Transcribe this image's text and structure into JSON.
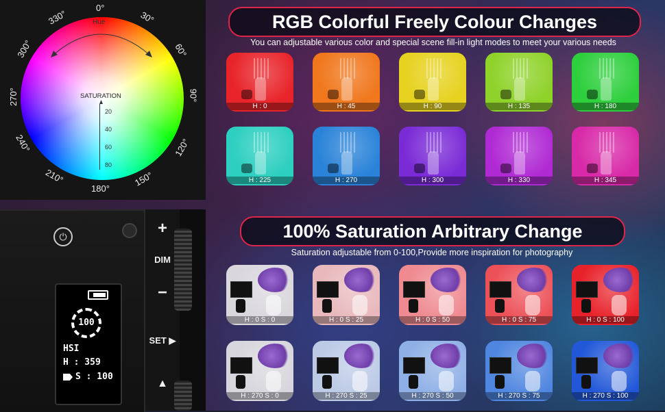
{
  "wheel": {
    "hue_label": "Hue",
    "saturation_label": "SATURATION",
    "degrees": [
      "0°",
      "30°",
      "60°",
      "90°",
      "120°",
      "150°",
      "180°",
      "210°",
      "240°",
      "270°",
      "300°",
      "330°"
    ],
    "saturation_ticks": [
      "20",
      "40",
      "60",
      "80"
    ]
  },
  "device": {
    "battery_value": "100",
    "mode": "HSI",
    "hue_line": "H : 359",
    "sat_line": "S : 100",
    "buttons": {
      "plus": "+",
      "dim": "DIM",
      "minus": "−",
      "set": "SET ▶",
      "up": "▲"
    }
  },
  "section1": {
    "title": "RGB Colorful Freely Colour Changes",
    "subtitle": "You can adjustable various color and special scene fill-in light modes to meet your various needs",
    "tiles": [
      {
        "label": "H : 0",
        "color": "#e8242a"
      },
      {
        "label": "H : 45",
        "color": "#f0771c"
      },
      {
        "label": "H : 90",
        "color": "#e6d21f"
      },
      {
        "label": "H : 135",
        "color": "#8fd22a"
      },
      {
        "label": "H : 180",
        "color": "#2ecf3d"
      },
      {
        "label": "H : 225",
        "color": "#2ccfc0"
      },
      {
        "label": "H : 270",
        "color": "#2a83d8"
      },
      {
        "label": "H : 300",
        "color": "#7a2bd6"
      },
      {
        "label": "H : 330",
        "color": "#b02ad4"
      },
      {
        "label": "H : 345",
        "color": "#d82aa8"
      }
    ]
  },
  "section2": {
    "title": "100% Saturation Arbitrary Change",
    "subtitle": "Saturation adjustable from 0-100,Provide more inspiration for photography",
    "tiles": [
      {
        "label": "H : 0   S : 0",
        "color": "#d9d6dc"
      },
      {
        "label": "H : 0   S : 25",
        "color": "#e8b8bc"
      },
      {
        "label": "H : 0   S : 50",
        "color": "#ee8a90"
      },
      {
        "label": "H : 0   S : 75",
        "color": "#ec5158"
      },
      {
        "label": "H : 0   S : 100",
        "color": "#e8222a"
      },
      {
        "label": "H : 270   S : 0",
        "color": "#d6d6dc"
      },
      {
        "label": "H : 270   S : 25",
        "color": "#bccae6"
      },
      {
        "label": "H : 270   S : 50",
        "color": "#8fb0e6"
      },
      {
        "label": "H : 270   S : 75",
        "color": "#4f86e0"
      },
      {
        "label": "H : 270   S : 100",
        "color": "#2258d8"
      }
    ]
  }
}
